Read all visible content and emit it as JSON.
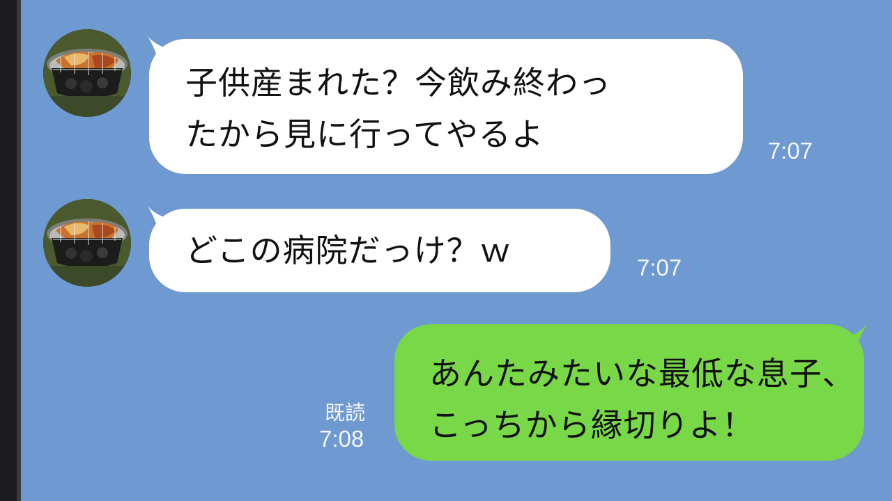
{
  "messages": [
    {
      "direction": "incoming",
      "avatar_icon": "grilled-meat-avatar-icon",
      "lines": [
        "子供産まれた？今飲み終わっ",
        "たから見に行ってやるよ"
      ],
      "time": "7:07"
    },
    {
      "direction": "incoming",
      "avatar_icon": "grilled-meat-avatar-icon",
      "lines": [
        "どこの病院だっけ？ｗ"
      ],
      "time": "7:07"
    },
    {
      "direction": "outgoing",
      "lines": [
        "あんたみたいな最低な息子、",
        "こっちから縁切りよ！"
      ],
      "read_label": "既読",
      "time": "7:08"
    }
  ],
  "colors": {
    "background": "#6f99d1",
    "incoming_bubble": "#ffffff",
    "outgoing_bubble": "#78d848",
    "meta_text": "#f3f6fb"
  }
}
